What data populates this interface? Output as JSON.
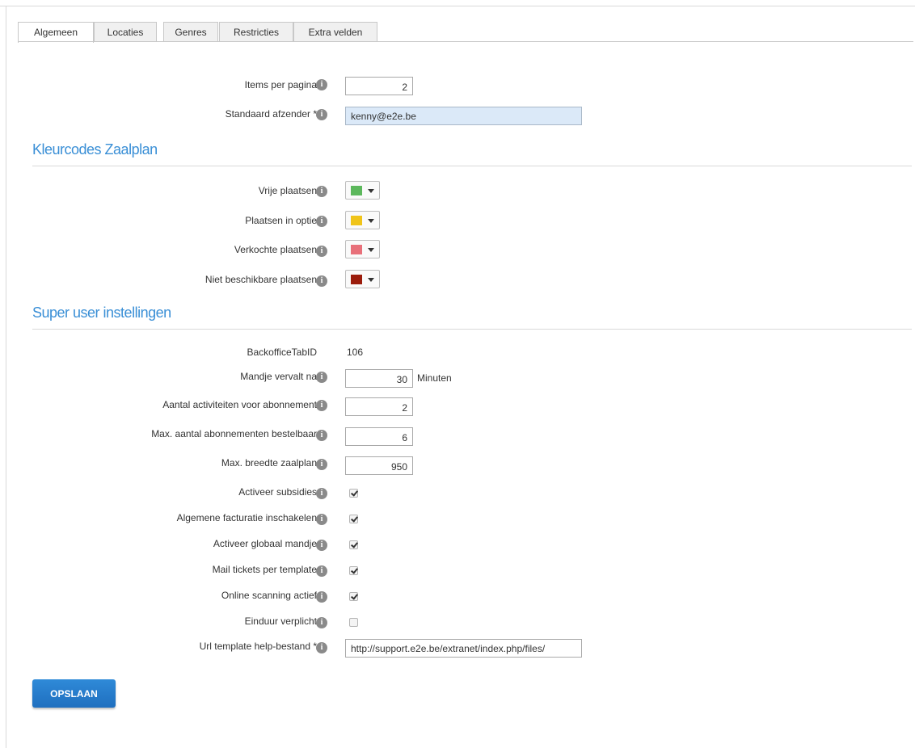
{
  "tabs": [
    "Algemeen",
    "Locaties",
    "Genres",
    "Restricties",
    "Extra velden"
  ],
  "active_tab": "Algemeen",
  "info_glyph": "i",
  "general": {
    "items_per_page": {
      "label": "Items per pagina",
      "value": "2"
    },
    "default_sender": {
      "label": "Standaard afzender *",
      "value": "kenny@e2e.be"
    }
  },
  "colors_section": {
    "title": "Kleurcodes Zaalplan",
    "items": [
      {
        "label": "Vrije plaatsen",
        "color": "#5cb85c"
      },
      {
        "label": "Plaatsen in optie",
        "color": "#f0c419"
      },
      {
        "label": "Verkochte plaatsen",
        "color": "#e8707a"
      },
      {
        "label": "Niet beschikbare plaatsen",
        "color": "#9b1c0c"
      }
    ]
  },
  "superuser_section": {
    "title": "Super user instellingen",
    "backoffice_tab_id": {
      "label": "BackofficeTabID",
      "value": "106"
    },
    "basket_expires": {
      "label": "Mandje vervalt na",
      "value": "30",
      "unit": "Minuten"
    },
    "activities_per_subscription": {
      "label": "Aantal activiteiten voor abonnement",
      "value": "2"
    },
    "max_subscriptions": {
      "label": "Max. aantal abonnementen bestelbaar",
      "value": "6"
    },
    "max_seatplan_width": {
      "label": "Max. breedte zaalplan",
      "value": "950"
    },
    "checkboxes": [
      {
        "label": "Activeer subsidies",
        "checked": true
      },
      {
        "label": "Algemene facturatie inschakelen",
        "checked": true
      },
      {
        "label": "Activeer globaal mandje",
        "checked": true
      },
      {
        "label": "Mail tickets per template",
        "checked": true
      },
      {
        "label": "Online scanning actief",
        "checked": true
      },
      {
        "label": "Einduur verplicht",
        "checked": false
      }
    ],
    "help_template_url": {
      "label": "Url template help-bestand *",
      "value": "http://support.e2e.be/extranet/index.php/files/"
    }
  },
  "save_label": "OPSLAAN"
}
